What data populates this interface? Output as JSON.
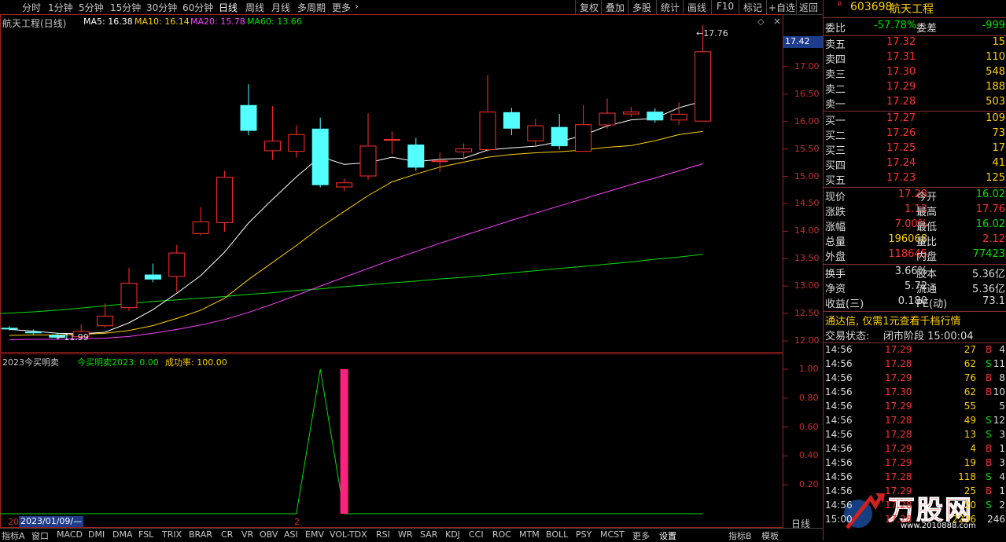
{
  "toolbar": {
    "periods": [
      "分时",
      "1分钟",
      "5分钟",
      "15分钟",
      "30分钟",
      "60分钟",
      "日线",
      "周线",
      "月线",
      "多周期",
      "更多"
    ],
    "active": "日线",
    "right_buttons": [
      "复权",
      "叠加",
      "多股",
      "统计",
      "画线",
      "F10",
      "标记",
      "+自选",
      "返回"
    ]
  },
  "chart": {
    "title": "航天工程(日线)",
    "ma": [
      {
        "label": "MA5: 16.38",
        "color": "#ffffff"
      },
      {
        "label": "MA10: 16.14",
        "color": "#ffd000"
      },
      {
        "label": "MA20: 15.78",
        "color": "#ff40ff"
      },
      {
        "label": "MA60: 13.66",
        "color": "#00e000"
      }
    ],
    "high_label": "17.76",
    "low_label": "11.99",
    "cur_price_label": "17.42",
    "y_ticks": [
      "17.00",
      "16.50",
      "16.00",
      "15.50",
      "15.00",
      "14.50",
      "14.00",
      "13.50",
      "13.00",
      "12.50",
      "12.00"
    ],
    "indicator_title": "2023今买明卖",
    "indicator_value": "今买明卖2023: 0.00",
    "indicator_rate": "成功率: 100.00",
    "ind_y_ticks": [
      "1.00",
      "0.80",
      "0.60",
      "0.40",
      "0.20"
    ],
    "date_label": "2023/01/09/—",
    "left_marker": "20",
    "mid_marker": "2",
    "period_tag": "日线",
    "colors": {
      "up": "#ff3030",
      "down": "#54ffff",
      "ma5": "#ffffff",
      "ma10": "#ffd000",
      "ma20": "#ff40ff",
      "ma60": "#00e000",
      "signal": "#00e000",
      "bar": "#ff2080"
    }
  },
  "chart_data": {
    "type": "candlestick",
    "y_range": [
      11.8,
      17.9
    ],
    "candles": [
      {
        "o": 12.24,
        "c": 12.21,
        "h": 12.27,
        "l": 12.19
      },
      {
        "o": 12.17,
        "c": 12.14,
        "h": 12.21,
        "l": 12.11
      },
      {
        "o": 12.11,
        "c": 12.06,
        "h": 12.15,
        "l": 12.03
      },
      {
        "o": 12.07,
        "c": 12.18,
        "h": 12.3,
        "l": 12.05
      },
      {
        "o": 12.27,
        "c": 12.46,
        "h": 12.68,
        "l": 12.24
      },
      {
        "o": 12.6,
        "c": 13.06,
        "h": 13.33,
        "l": 12.55
      },
      {
        "o": 13.21,
        "c": 13.12,
        "h": 13.41,
        "l": 13.07
      },
      {
        "o": 13.17,
        "c": 13.61,
        "h": 13.75,
        "l": 12.89
      },
      {
        "o": 13.95,
        "c": 14.18,
        "h": 14.44,
        "l": 13.92
      },
      {
        "o": 14.15,
        "c": 14.99,
        "h": 15.1,
        "l": 13.99
      },
      {
        "o": 16.3,
        "c": 15.83,
        "h": 16.68,
        "l": 15.75
      },
      {
        "o": 15.46,
        "c": 15.65,
        "h": 16.28,
        "l": 15.3
      },
      {
        "o": 15.45,
        "c": 15.77,
        "h": 15.93,
        "l": 15.34
      },
      {
        "o": 15.87,
        "c": 14.84,
        "h": 16.07,
        "l": 14.8
      },
      {
        "o": 14.8,
        "c": 14.89,
        "h": 14.96,
        "l": 14.73
      },
      {
        "o": 15.0,
        "c": 15.56,
        "h": 16.15,
        "l": 14.94
      },
      {
        "o": 15.65,
        "c": 15.68,
        "h": 15.82,
        "l": 15.41
      },
      {
        "o": 15.58,
        "c": 15.16,
        "h": 15.7,
        "l": 15.1
      },
      {
        "o": 15.28,
        "c": 15.29,
        "h": 15.44,
        "l": 15.08
      },
      {
        "o": 15.44,
        "c": 15.51,
        "h": 15.6,
        "l": 15.3
      },
      {
        "o": 15.48,
        "c": 16.18,
        "h": 16.85,
        "l": 15.45
      },
      {
        "o": 16.17,
        "c": 15.87,
        "h": 16.25,
        "l": 15.75
      },
      {
        "o": 15.64,
        "c": 15.93,
        "h": 16.05,
        "l": 15.56
      },
      {
        "o": 15.9,
        "c": 15.55,
        "h": 16.14,
        "l": 15.49
      },
      {
        "o": 15.45,
        "c": 15.95,
        "h": 16.3,
        "l": 15.45
      },
      {
        "o": 15.93,
        "c": 16.16,
        "h": 16.42,
        "l": 15.87
      },
      {
        "o": 16.13,
        "c": 16.18,
        "h": 16.27,
        "l": 16.08
      },
      {
        "o": 16.18,
        "c": 16.02,
        "h": 16.24,
        "l": 15.98
      },
      {
        "o": 16.02,
        "c": 16.14,
        "h": 16.35,
        "l": 15.94
      },
      {
        "o": 16.0,
        "c": 17.28,
        "h": 17.76,
        "l": 16.0
      }
    ],
    "ma5": [
      12.21,
      12.18,
      12.14,
      12.13,
      12.16,
      12.33,
      12.57,
      12.87,
      13.19,
      13.62,
      14.15,
      14.58,
      14.99,
      15.36,
      15.22,
      15.25,
      15.35,
      15.27,
      15.31,
      15.33,
      15.48,
      15.52,
      15.55,
      15.63,
      15.75,
      15.92,
      16.03,
      16.06,
      16.25,
      16.37
    ],
    "ma10": [
      12.1,
      12.11,
      12.11,
      12.12,
      12.14,
      12.19,
      12.28,
      12.41,
      12.56,
      12.78,
      13.12,
      13.43,
      13.74,
      14.07,
      14.36,
      14.65,
      14.9,
      15.04,
      15.17,
      15.26,
      15.35,
      15.4,
      15.43,
      15.45,
      15.48,
      15.53,
      15.56,
      15.65,
      15.76,
      15.82
    ],
    "ma20": [
      12.02,
      12.03,
      12.03,
      12.04,
      12.05,
      12.08,
      12.14,
      12.21,
      12.29,
      12.39,
      12.52,
      12.67,
      12.83,
      13.0,
      13.16,
      13.32,
      13.48,
      13.63,
      13.78,
      13.92,
      14.06,
      14.2,
      14.33,
      14.46,
      14.59,
      14.72,
      14.85,
      14.97,
      15.1,
      15.23
    ],
    "ma60": [
      12.5,
      12.53,
      12.56,
      12.6,
      12.64,
      12.68,
      12.72,
      12.75,
      12.78,
      12.81,
      12.85,
      12.88,
      12.92,
      12.95,
      12.99,
      13.02,
      13.06,
      13.09,
      13.13,
      13.16,
      13.2,
      13.24,
      13.28,
      13.32,
      13.36,
      13.4,
      13.44,
      13.49,
      13.53,
      13.58
    ],
    "indicator": [
      0,
      0,
      0,
      0,
      0,
      0,
      0,
      0,
      0,
      0,
      0,
      0,
      0,
      1,
      0,
      0,
      0,
      0,
      0,
      0,
      0,
      0,
      0,
      0,
      0,
      0,
      0,
      0,
      0,
      0
    ],
    "indicator_bar_index": 14
  },
  "panel": {
    "code": "603698",
    "name": "航天工程",
    "webi_label": "委比",
    "webi_value": "-57.78%",
    "weicha_label": "委差",
    "weicha_value": "-999",
    "asks": [
      {
        "label": "卖五",
        "price": "17.32",
        "vol": "15"
      },
      {
        "label": "卖四",
        "price": "17.31",
        "vol": "110"
      },
      {
        "label": "卖三",
        "price": "17.30",
        "vol": "548"
      },
      {
        "label": "卖二",
        "price": "17.29",
        "vol": "188"
      },
      {
        "label": "卖一",
        "price": "17.28",
        "vol": "503"
      }
    ],
    "bids": [
      {
        "label": "买一",
        "price": "17.27",
        "vol": "109"
      },
      {
        "label": "买二",
        "price": "17.26",
        "vol": "73"
      },
      {
        "label": "买三",
        "price": "17.25",
        "vol": "17"
      },
      {
        "label": "买四",
        "price": "17.24",
        "vol": "41"
      },
      {
        "label": "买五",
        "price": "17.23",
        "vol": "125"
      }
    ],
    "stats": [
      {
        "l1": "现价",
        "v1": "17.28",
        "c1": "red",
        "l2": "今开",
        "v2": "16.02",
        "c2": "green"
      },
      {
        "l1": "涨跌",
        "v1": "1.13",
        "c1": "red",
        "l2": "最高",
        "v2": "17.76",
        "c2": "red"
      },
      {
        "l1": "涨幅",
        "v1": "7.00%",
        "c1": "red",
        "l2": "最低",
        "v2": "16.02",
        "c2": "green"
      },
      {
        "l1": "总量",
        "v1": "196068",
        "c1": "yellow",
        "l2": "量比",
        "v2": "2.12",
        "c2": "red"
      },
      {
        "l1": "外盘",
        "v1": "118645",
        "c1": "red",
        "l2": "内盘",
        "v2": "77423",
        "c2": "green"
      }
    ],
    "stats2": [
      {
        "l1": "换手",
        "v1": "3.66%",
        "l2": "股本",
        "v2": "5.36亿"
      },
      {
        "l1": "净资",
        "v1": "5.72",
        "l2": "流通",
        "v2": "5.36亿"
      },
      {
        "l1": "收益(三)",
        "v1": "0.180",
        "l2": "PE(动)",
        "v2": "73.1"
      }
    ],
    "promo": "通达信, 仅需1元查看千档行情",
    "trade_state_label": "交易状态:",
    "trade_state_value": "闭市阶段 15:00:04",
    "ticks": [
      {
        "t": "14:56",
        "p": "17.29",
        "v": "27",
        "bs": "B",
        "n": "4"
      },
      {
        "t": "14:56",
        "p": "17.28",
        "v": "62",
        "bs": "S",
        "n": "11"
      },
      {
        "t": "14:56",
        "p": "17.29",
        "v": "76",
        "bs": "B",
        "n": "8"
      },
      {
        "t": "14:56",
        "p": "17.30",
        "v": "62",
        "bs": "B",
        "n": "10"
      },
      {
        "t": "14:56",
        "p": "17.29",
        "v": "55",
        "bs": "",
        "n": "5"
      },
      {
        "t": "14:56",
        "p": "17.28",
        "v": "49",
        "bs": "S",
        "n": "12"
      },
      {
        "t": "14:56",
        "p": "17.28",
        "v": "13",
        "bs": "S",
        "n": "3"
      },
      {
        "t": "14:56",
        "p": "17.29",
        "v": "4",
        "bs": "B",
        "n": "1"
      },
      {
        "t": "14:56",
        "p": "17.29",
        "v": "19",
        "bs": "B",
        "n": "3"
      },
      {
        "t": "14:56",
        "p": "17.28",
        "v": "118",
        "bs": "S",
        "n": "4"
      },
      {
        "t": "14:56",
        "p": "17.29",
        "v": "25",
        "bs": "B",
        "n": "1"
      },
      {
        "t": "14:56",
        "p": "17.28",
        "v": "20",
        "bs": "S",
        "n": "2"
      },
      {
        "t": "15:00",
        "p": "17.28",
        "v": "2236",
        "bs": "",
        "n": "246"
      }
    ],
    "watermark": "万股网",
    "watermark_url": "www.2010888.com"
  },
  "bottom_tabs": [
    "指标A",
    "窗口",
    "MACD",
    "DMI",
    "DMA",
    "FSL",
    "TRIX",
    "BRAR",
    "CR",
    "VR",
    "OBV",
    "ASI",
    "EMV",
    "VOL-TDX",
    "RSI",
    "WR",
    "SAR",
    "KDJ",
    "CCI",
    "ROC",
    "MTM",
    "BOLL",
    "PSY",
    "MCST",
    "更多",
    "设置"
  ],
  "bottom_right_tabs": [
    "指标B",
    "模板"
  ]
}
